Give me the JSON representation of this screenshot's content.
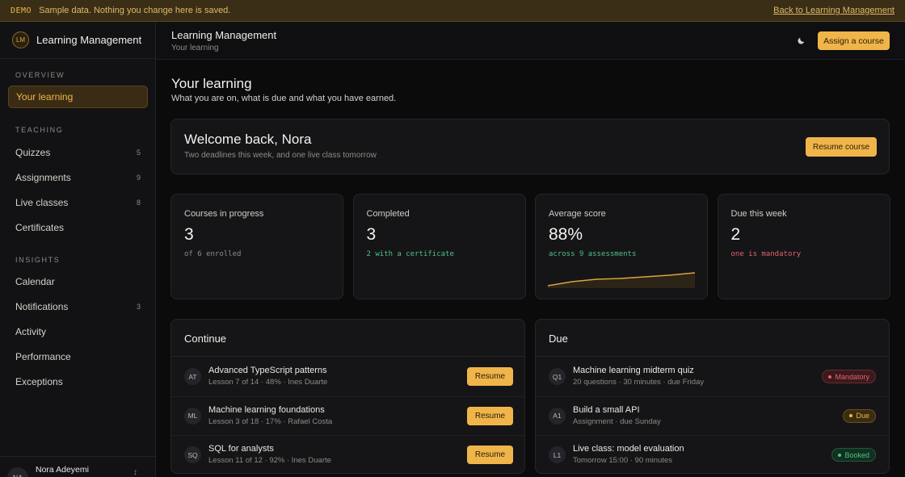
{
  "banner": {
    "tag": "DEMO",
    "message": "Sample data. Nothing you change here is saved.",
    "back_link": "Back to Learning Management"
  },
  "sidebar": {
    "logo": "LM",
    "brand": "Learning Management",
    "sections": [
      {
        "title": "OVERVIEW",
        "items": [
          {
            "label": "Your learning",
            "count": "",
            "active": true
          }
        ]
      },
      {
        "title": "TEACHING",
        "items": [
          {
            "label": "Quizzes",
            "count": "5"
          },
          {
            "label": "Assignments",
            "count": "9"
          },
          {
            "label": "Live classes",
            "count": "8"
          },
          {
            "label": "Certificates",
            "count": ""
          }
        ]
      },
      {
        "title": "INSIGHTS",
        "items": [
          {
            "label": "Calendar",
            "count": ""
          },
          {
            "label": "Notifications",
            "count": "3"
          },
          {
            "label": "Activity",
            "count": ""
          },
          {
            "label": "Performance",
            "count": ""
          },
          {
            "label": "Exceptions",
            "count": ""
          }
        ]
      }
    ],
    "user": {
      "initials": "NA",
      "name": "Nora Adeyemi"
    }
  },
  "topbar": {
    "title": "Learning Management",
    "subtitle": "Your learning",
    "assign_label": "Assign a course",
    "theme_icon": "moon-icon"
  },
  "page": {
    "title": "Your learning",
    "subtitle": "What you are on, what is due and what you have earned."
  },
  "welcome": {
    "heading": "Welcome back, Nora",
    "sub": "Two deadlines this week, and one live class tomorrow",
    "button": "Resume course"
  },
  "stats": [
    {
      "label": "Courses in progress",
      "value": "3",
      "note": "of 6 enrolled",
      "note_color": "#8e8b86"
    },
    {
      "label": "Completed",
      "value": "3",
      "note": "2 with a certificate",
      "note_color": "#4fc08d"
    },
    {
      "label": "Average score",
      "value": "88%",
      "note": "across 9 assessments",
      "note_color": "#4fc08d"
    },
    {
      "label": "Due this week",
      "value": "2",
      "note": "one is mandatory",
      "note_color": "#e5606a"
    }
  ],
  "continue": {
    "title": "Continue",
    "button_label": "Resume",
    "items": [
      {
        "code": "AT",
        "title": "Advanced TypeScript patterns",
        "meta": "Lesson 7 of 14 · 48% · Ines Duarte"
      },
      {
        "code": "ML",
        "title": "Machine learning foundations",
        "meta": "Lesson 3 of 18 · 17% · Rafael Costa"
      },
      {
        "code": "SQ",
        "title": "SQL for analysts",
        "meta": "Lesson 11 of 12 · 92% · Ines Duarte"
      }
    ]
  },
  "due": {
    "title": "Due",
    "items": [
      {
        "code": "Q1",
        "title": "Machine learning midterm quiz",
        "meta": "20 questions · 30 minutes · due Friday",
        "badge": "Mandatory",
        "badge_color": "#e5606a",
        "badge_bg": "#3a1a1e",
        "badge_border": "#6a2a30"
      },
      {
        "code": "A1",
        "title": "Build a small API",
        "meta": "Assignment · due Sunday",
        "badge": "Due",
        "badge_color": "#f0b54a",
        "badge_bg": "#3a2c10",
        "badge_border": "#6a5020"
      },
      {
        "code": "L1",
        "title": "Live class: model evaluation",
        "meta": "Tomorrow 15:00 · 90 minutes",
        "badge": "Booked",
        "badge_color": "#4fc08d",
        "badge_bg": "#12301f",
        "badge_border": "#1f5a3a"
      }
    ]
  }
}
